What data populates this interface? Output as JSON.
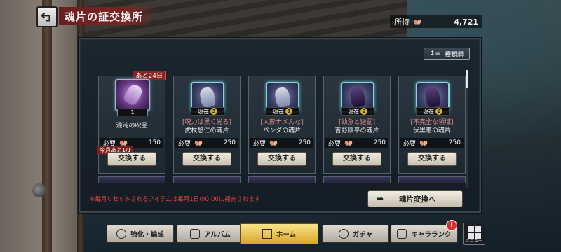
{
  "header": {
    "title": "魂片の証交換所",
    "owned_label": "所持",
    "owned_value": "4,721"
  },
  "panel": {
    "sort_label": "種類順",
    "cards": [
      {
        "limit_badge": "あと24日",
        "quantity": "1",
        "name_sub": "",
        "name": "混沌の呪品",
        "cost_label": "必要",
        "cost_value": "150",
        "month_limit": "今月あと1/1",
        "button": "交換する",
        "icon": "cursed-object-icon"
      },
      {
        "current_label": "現在",
        "current_count": "3",
        "name_sub": "[呪力は黒く光る]",
        "name": "虎杖悠仁の魂片",
        "cost_label": "必要",
        "cost_value": "250",
        "button": "交換する",
        "icon": "hand-icon"
      },
      {
        "current_label": "現在",
        "current_count": "1",
        "name_sub": "[人形ナメんな]",
        "name": "パンダの魂片",
        "cost_label": "必要",
        "cost_value": "250",
        "button": "交換する",
        "icon": "hand-icon"
      },
      {
        "current_label": "現在",
        "current_count": "2",
        "name_sub": "[幼魚と逆罰]",
        "name": "吉野順平の魂片",
        "cost_label": "必要",
        "cost_value": "250",
        "button": "交換する",
        "icon": "hand-icon"
      },
      {
        "current_label": "現在",
        "current_count": "2",
        "name_sub": "[不完全な領域]",
        "name": "伏黒恵の魂片",
        "cost_label": "必要",
        "cost_value": "250",
        "button": "交換する",
        "icon": "hand-icon"
      }
    ],
    "note": "※毎月リセットされるアイテムは毎月1日の0:00に補充されます",
    "convert_button": "魂片変換へ"
  },
  "nav": {
    "items": [
      {
        "label": "強化・編成",
        "icon": "team-icon"
      },
      {
        "label": "アルバム",
        "icon": "album-icon"
      },
      {
        "label": "ホーム",
        "icon": "home-icon"
      },
      {
        "label": "ガチャ",
        "icon": "gacha-icon"
      },
      {
        "label": "キャラランク",
        "icon": "rank-icon"
      }
    ],
    "alert": "!",
    "menu_label": "メニュー"
  },
  "colors": {
    "title_bg": "#7c2525",
    "active_nav": "#d9a72c",
    "note_text": "#e8413a",
    "badge_red": "#8a2424"
  }
}
